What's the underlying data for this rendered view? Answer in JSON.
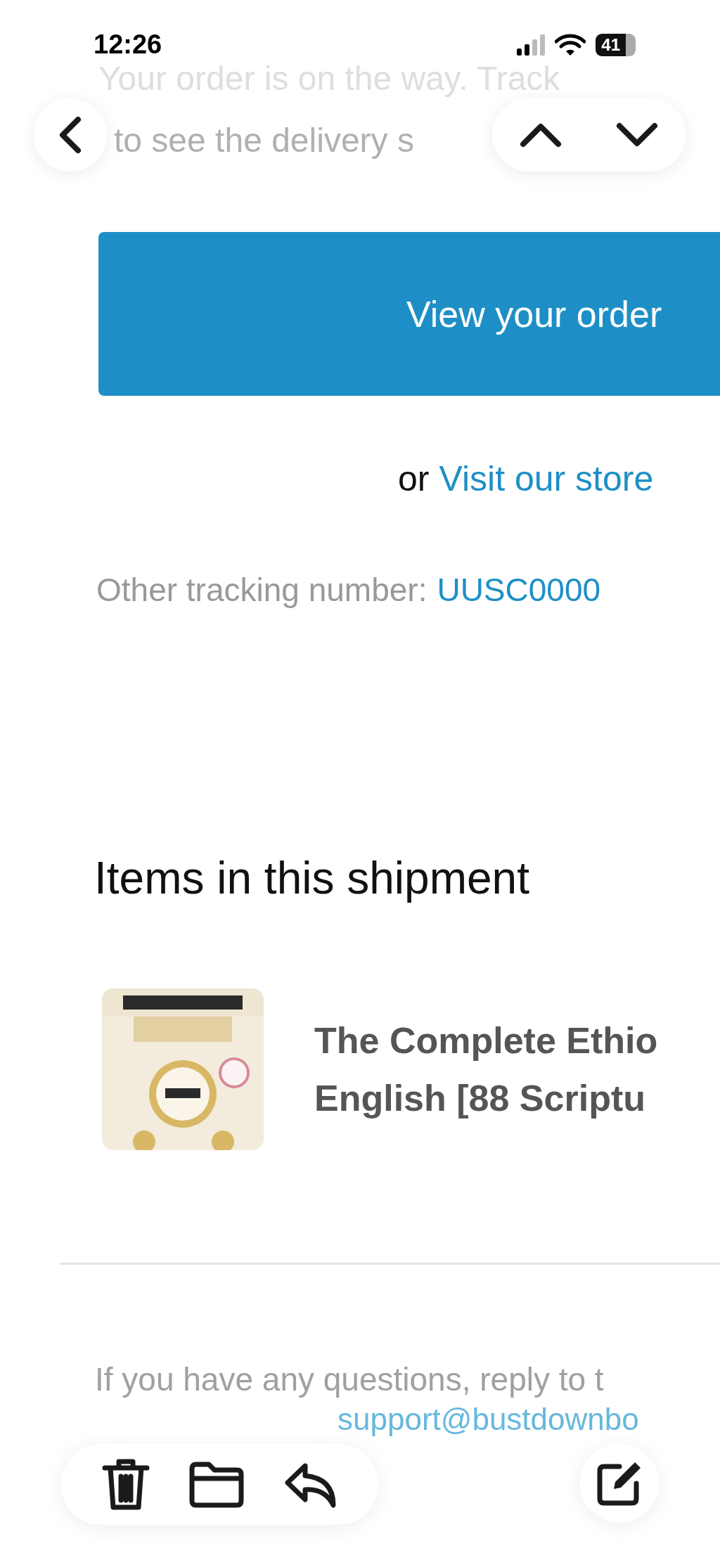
{
  "status_bar": {
    "time": "12:26",
    "battery": "41"
  },
  "intro_lines": [
    "Your order is on the way. Track",
    "to see the delivery s"
  ],
  "view_order_button": "View your order",
  "store_line": {
    "prefix": "or",
    "link": "Visit our store"
  },
  "tracking": {
    "label": "Other tracking number:",
    "number": "UUSC0000"
  },
  "items_heading": "Items in this shipment",
  "items": [
    {
      "title_lines": [
        "The Complete Ethio",
        "English [88 Scriptu"
      ]
    }
  ],
  "footer": {
    "question": "If you have any questions, reply to t",
    "email": "support@bustdownbo"
  }
}
